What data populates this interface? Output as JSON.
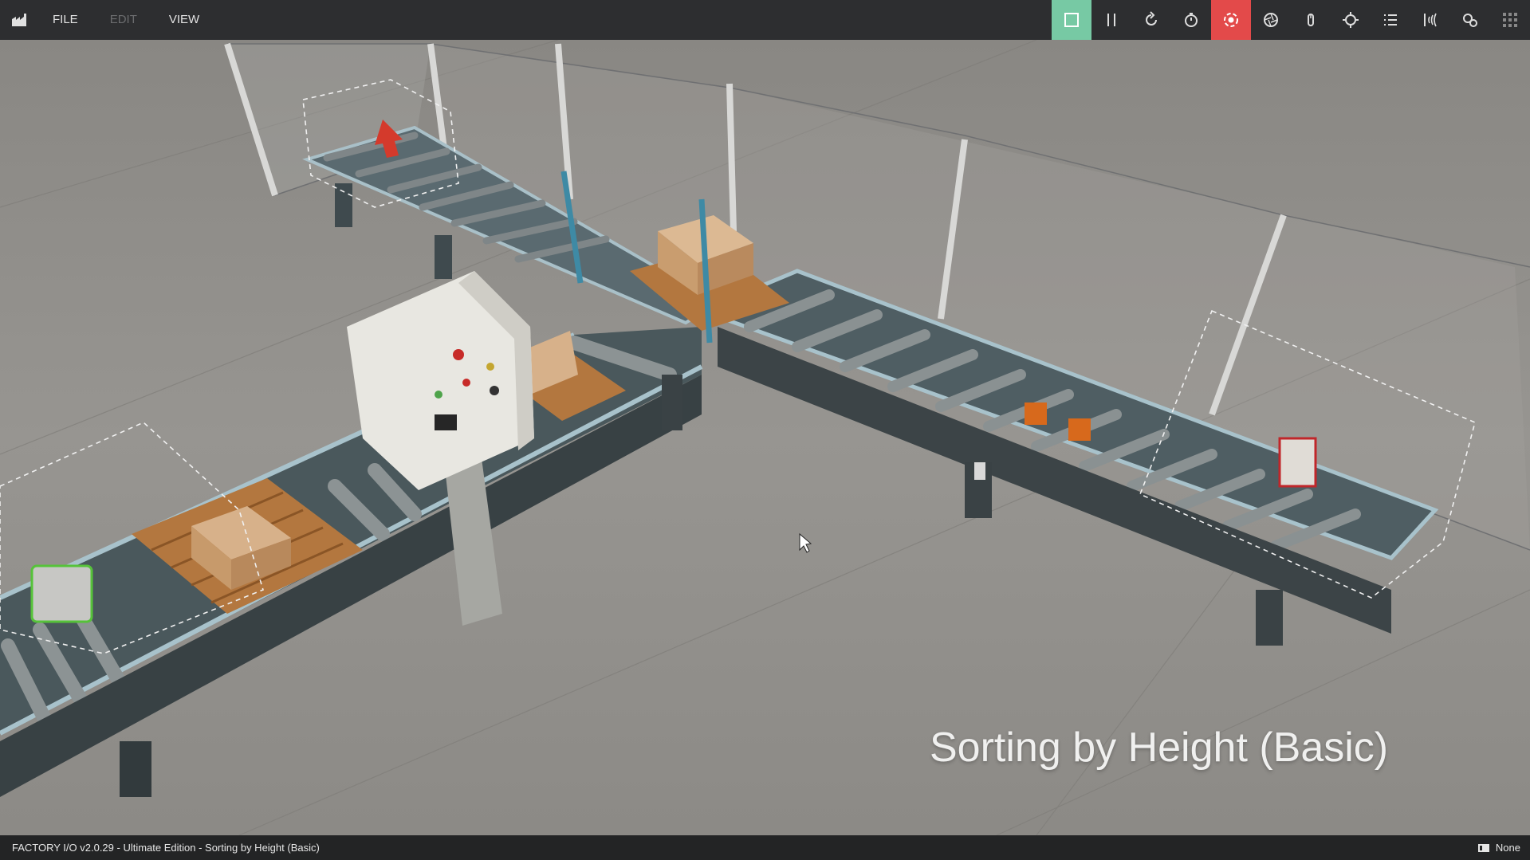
{
  "menu": {
    "file": "FILE",
    "edit": "EDIT",
    "view": "VIEW"
  },
  "toolbar": {
    "icons": [
      "edit-mode-icon",
      "pause-icon",
      "reset-icon",
      "timer-icon",
      "run-mode-icon",
      "aperture-icon",
      "hand-icon",
      "target-icon",
      "list-icon",
      "sensor-icon",
      "drivers-icon",
      "grid-icon"
    ],
    "active_green": "#77c9a4",
    "active_red": "#e34a4a"
  },
  "scene": {
    "title": "Sorting by Height (Basic)"
  },
  "status": {
    "text": "FACTORY I/O v2.0.29 - Ultimate Edition - Sorting by Height (Basic)",
    "driver": "None"
  }
}
